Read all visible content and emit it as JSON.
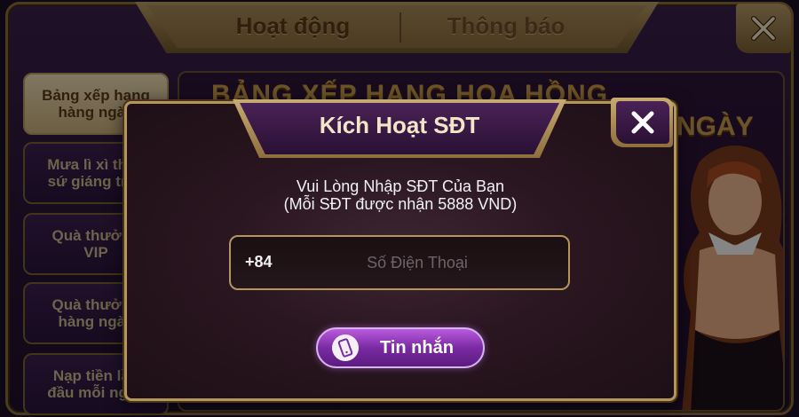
{
  "background": {
    "tabs": [
      {
        "label": "Hoạt động",
        "active": true
      },
      {
        "label": "Thông báo",
        "active": false
      }
    ],
    "close_icon": "close-icon",
    "sidebar": {
      "items": [
        {
          "line1": "Bảng xếp hạng",
          "line2": "hàng ngày",
          "active": true
        },
        {
          "line1": "Mưa lì xì thần",
          "line2": "sứ giáng trần",
          "active": false
        },
        {
          "line1": "Quà thưởng",
          "line2": "VIP",
          "active": false
        },
        {
          "line1": "Quà thưởng",
          "line2": "hàng ngày",
          "active": false
        },
        {
          "line1": "Nạp tiền lần",
          "line2": "đầu mỗi ngày",
          "active": false
        }
      ]
    },
    "banner": {
      "title": "BẢNG XẾP HẠNG HOA HỒNG",
      "day": "NGÀY"
    }
  },
  "modal": {
    "title": "Kích Hoạt SĐT",
    "close_icon": "close-icon",
    "message_line1": "Vui Lòng Nhập SĐT Của Bạn",
    "message_line2": "(Mỗi SĐT được nhận 5888 VND)",
    "phone": {
      "prefix": "+84",
      "value": "",
      "placeholder": "Số Điện Thoại"
    },
    "sms_button": {
      "label": "Tin nhắn",
      "icon": "phone-icon"
    }
  },
  "colors": {
    "gold": "#b4955c",
    "purple_button": "#7a2aa2",
    "panel": "#2a1620"
  }
}
